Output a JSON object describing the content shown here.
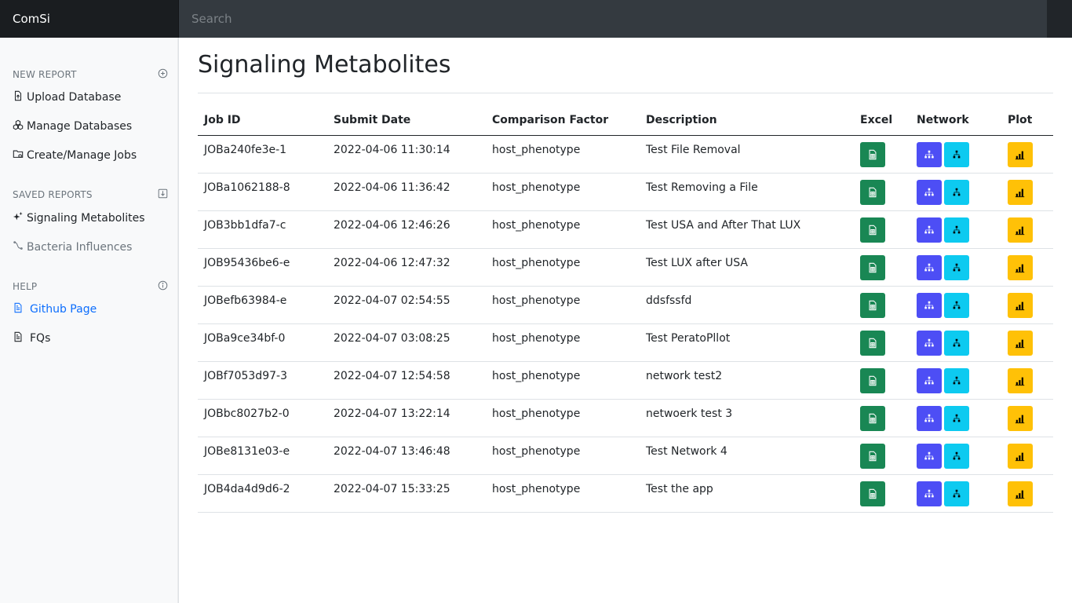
{
  "app": {
    "brand": "ComSi",
    "search_placeholder": "Search"
  },
  "sidebar": {
    "sections": [
      {
        "title": "NEW REPORT",
        "icon": "plus-circle-icon",
        "items": [
          {
            "label": "Upload Database",
            "icon": "file-upload-icon"
          },
          {
            "label": "Manage Databases",
            "icon": "boxes-icon"
          },
          {
            "label": "Create/Manage Jobs",
            "icon": "folder-gear-icon"
          }
        ]
      },
      {
        "title": "SAVED REPORTS",
        "icon": "download-box-icon",
        "items": [
          {
            "label": "Signaling Metabolites",
            "icon": "sparkles-icon"
          },
          {
            "label": "Bacteria Influences",
            "icon": "bacteria-icon"
          }
        ]
      },
      {
        "title": "HELP",
        "icon": "info-circle-icon",
        "items": [
          {
            "label": "Github Page",
            "icon": "document-icon"
          },
          {
            "label": "FQs",
            "icon": "document-icon"
          }
        ]
      }
    ]
  },
  "main": {
    "title": "Signaling Metabolites",
    "columns": [
      "Job ID",
      "Submit Date",
      "Comparison Factor",
      "Description",
      "Excel",
      "Network",
      "Plot"
    ],
    "rows": [
      {
        "job_id": "JOBa240fe3e-1",
        "date": "2022-04-06 11:30:14",
        "factor": "host_phenotype",
        "description": "Test File Removal"
      },
      {
        "job_id": "JOBa1062188-8",
        "date": "2022-04-06 11:36:42",
        "factor": "host_phenotype",
        "description": "Test Removing a File"
      },
      {
        "job_id": "JOB3bb1dfa7-c",
        "date": "2022-04-06 12:46:26",
        "factor": "host_phenotype",
        "description": "Test USA and After That LUX"
      },
      {
        "job_id": "JOB95436be6-e",
        "date": "2022-04-06 12:47:32",
        "factor": "host_phenotype",
        "description": "Test LUX after USA"
      },
      {
        "job_id": "JOBefb63984-e",
        "date": "2022-04-07 02:54:55",
        "factor": "host_phenotype",
        "description": "ddsfssfd"
      },
      {
        "job_id": "JOBa9ce34bf-0",
        "date": "2022-04-07 03:08:25",
        "factor": "host_phenotype",
        "description": "Test PeratoPllot"
      },
      {
        "job_id": "JOBf7053d97-3",
        "date": "2022-04-07 12:54:58",
        "factor": "host_phenotype",
        "description": "network test2"
      },
      {
        "job_id": "JOBbc8027b2-0",
        "date": "2022-04-07 13:22:14",
        "factor": "host_phenotype",
        "description": "netwoerk test 3"
      },
      {
        "job_id": "JOBe8131e03-e",
        "date": "2022-04-07 13:46:48",
        "factor": "host_phenotype",
        "description": "Test Network 4"
      },
      {
        "job_id": "JOB4da4d9d6-2",
        "date": "2022-04-07 15:33:25",
        "factor": "host_phenotype",
        "description": "Test the app"
      }
    ],
    "row_icons": {
      "excel": "spreadsheet-icon",
      "network": "network-tree-icon",
      "network_alt": "hierarchy-icon",
      "plot": "bar-chart-icon"
    }
  },
  "colors": {
    "excel": "#198754",
    "network": "#4d4ef5",
    "network_alt": "#0dcaf0",
    "plot": "#ffc107",
    "link": "#0d6efd",
    "topbar": "#212529"
  }
}
